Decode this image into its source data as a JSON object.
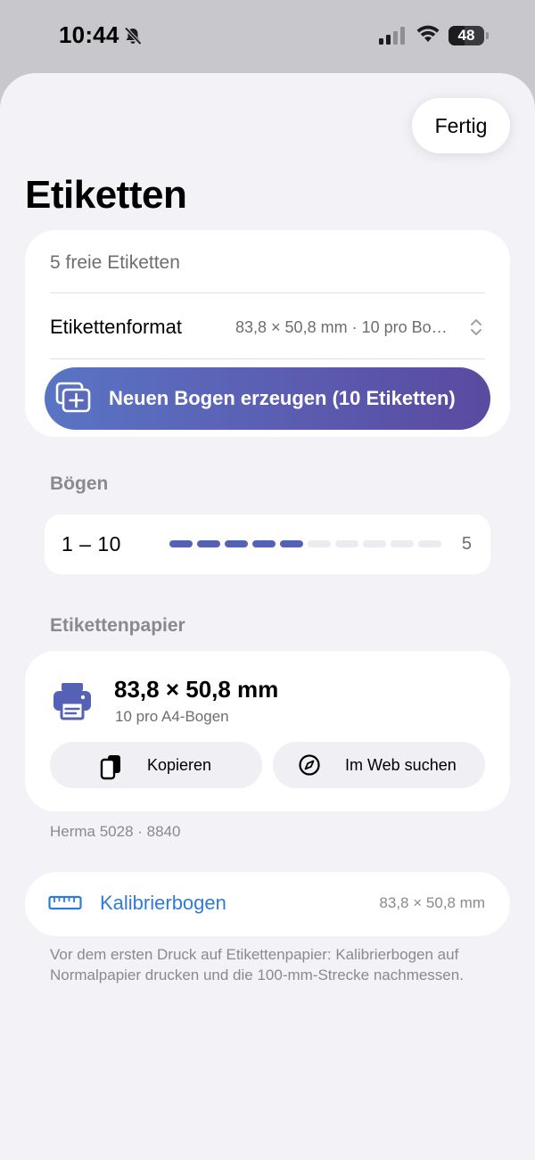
{
  "status_bar": {
    "time": "10:44",
    "battery": "48"
  },
  "toolbar": {
    "done_label": "Fertig"
  },
  "page": {
    "title": "Etiketten"
  },
  "labels_card": {
    "free_labels": "5 freie Etiketten",
    "format_label": "Etikettenformat",
    "format_value": "83,8 × 50,8 mm · 10 pro Bo…",
    "create_button": "Neuen Bogen erzeugen (10 Etiketten)"
  },
  "sheets_section": {
    "header": "Bögen",
    "range_label": "1 – 10",
    "progress_filled": 5,
    "progress_total": 10,
    "count": "5"
  },
  "paper_section": {
    "header": "Etikettenpapier",
    "size": "83,8 × 50,8 mm",
    "subtitle": "10 pro A4-Bogen",
    "copy_button": "Kopieren",
    "web_button": "Im Web suchen",
    "footnote": "Herma 5028 · 8840"
  },
  "calibration": {
    "label": "Kalibrierbogen",
    "value": "83,8 × 50,8 mm",
    "note": "Vor dem ersten Druck auf Etikettenpapier: Kalibrierbogen auf Normalpapier drucken und die 100-mm-Strecke nachmessen."
  },
  "colors": {
    "accent": "#5561b5",
    "link": "#2f7bd6",
    "background": "#f2f2f7"
  },
  "icons": [
    "bell-slash-icon",
    "cellular-signal-icon",
    "wifi-icon",
    "battery-icon",
    "add-sheet-icon",
    "updown-chevron-icon",
    "printer-icon",
    "copy-icon",
    "compass-icon",
    "ruler-icon"
  ]
}
